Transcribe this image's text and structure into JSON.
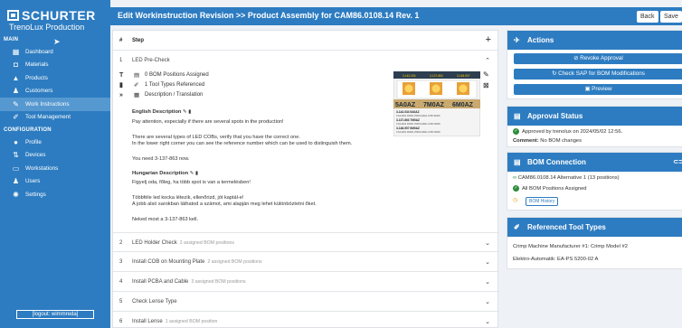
{
  "brand": {
    "name": "SCHURTER",
    "sub": "TrenoLux Production"
  },
  "sidebar": {
    "main_label": "MAIN",
    "items": [
      {
        "label": "Dashboard",
        "icon": "dashboard-icon",
        "glyph": "▦"
      },
      {
        "label": "Materials",
        "icon": "materials-icon",
        "glyph": "◘"
      },
      {
        "label": "Products",
        "icon": "products-icon",
        "glyph": "▲"
      },
      {
        "label": "Customers",
        "icon": "customers-icon",
        "glyph": "♟"
      },
      {
        "label": "Work Instructions",
        "icon": "work-instructions-icon",
        "glyph": "✎"
      },
      {
        "label": "Tool Management",
        "icon": "tool-icon",
        "glyph": "✐"
      }
    ],
    "config_label": "CONFIGURATION",
    "config_items": [
      {
        "label": "Profile",
        "icon": "profile-icon",
        "glyph": "●"
      },
      {
        "label": "Devices",
        "icon": "devices-icon",
        "glyph": "⇅"
      },
      {
        "label": "Workstations",
        "icon": "workstations-icon",
        "glyph": "▭"
      },
      {
        "label": "Users",
        "icon": "users-icon",
        "glyph": "♟"
      },
      {
        "label": "Settings",
        "icon": "settings-icon",
        "glyph": "✺"
      }
    ],
    "logout": "[logout: wimmreda]"
  },
  "header": {
    "title": "Edit Workinstruction Revision >> Product Assembly for CAM86.0108.14 Rev. 1",
    "back": "Back",
    "save": "Save"
  },
  "table": {
    "col_num": "#",
    "col_step": "Step"
  },
  "step1": {
    "num": "1",
    "title": "LED Pre-Check",
    "bom": "0 BOM Positions Assigned",
    "tools": "1 Tool Types Referenced",
    "desc": "Description / Translation",
    "en_title": "English Description",
    "en_lines": [
      "Pay attention, especially if there are several spots in the production!",
      "There are several types of LED COBs, verify that you have the correct one.",
      "In the lower right corner you can see the reference number which can be used to distinguish them.",
      "You need 3-137-863 now."
    ],
    "hu_title": "Hungarian Description",
    "hu_lines": [
      "Figyelj oda, főleg, ha több spot is van a termelésben!",
      "Többféle led kocka létezik, ellenőrizd, jót kaptál-e!",
      "A jobb alsó sarokban láthatod a számot, ami alapján meg lehet különböztetni őket.",
      "Neked most a 3-137-863 kell."
    ]
  },
  "thumb": {
    "codes_top": [
      "3-142-034",
      "3-137-863",
      "3-148-907"
    ],
    "labels": [
      "5A0AZ",
      "7M0AZ",
      "6M0AZ"
    ],
    "refs": [
      {
        "code": "3-142-034  5A0AZ",
        "desc": "CXA1304 3000K 25RCGMAA COB 3000K"
      },
      {
        "code": "3-137-863  7M0AZ",
        "desc": "CXA1304 3000K 25RCGNRH COB 3000K"
      },
      {
        "code": "3-148-907  6M0AZ",
        "desc": "CXA1304 3000K 25RCGNRH COB 3000K"
      }
    ]
  },
  "steps": [
    {
      "num": "2",
      "title": "LED Holder Check",
      "meta": "2 assigned BOM positions"
    },
    {
      "num": "3",
      "title": "Install COB on Mounting Plate",
      "meta": "2 assigned BOM positions"
    },
    {
      "num": "4",
      "title": "Install PCBA and Cable",
      "meta": "3 assigned BOM positions"
    },
    {
      "num": "5",
      "title": "Check Lense Type",
      "meta": ""
    },
    {
      "num": "6",
      "title": "Install Lense",
      "meta": "1 assigned BOM position"
    }
  ],
  "actions": {
    "title": "Actions",
    "revoke": "Revoke Approval",
    "check": "Check SAP for BOM Modifications",
    "preview": "Preview"
  },
  "approval": {
    "title": "Approval Status",
    "line": "Approved by trenolux on 2024/05/02 12:56.",
    "comment_label": "Comment:",
    "comment": "No BOM changes"
  },
  "bomconn": {
    "title": "BOM Connection",
    "link": "CAM86.0108.14 Alternative 1 (13 positions)",
    "assigned": "All BOM Positions Assigned",
    "history": "BOM History"
  },
  "tooltypes": {
    "title": "Referenced Tool Types",
    "items": [
      "Crimp Machine Manufacturer #1: Crimp Model #2",
      "Elektro-Automatik: EA-PS 5200-02 A"
    ]
  },
  "colors": {
    "primary": "#2d7cc1",
    "active_nav": "#5698d0",
    "success": "#2e8b3c"
  }
}
